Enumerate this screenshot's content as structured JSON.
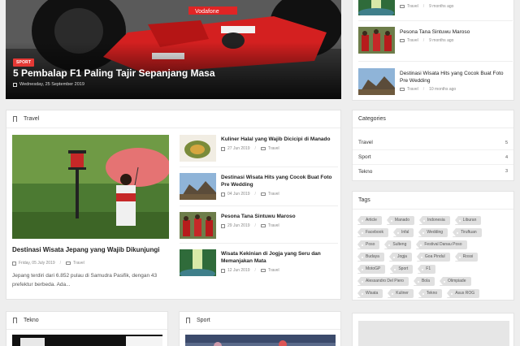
{
  "hero": {
    "badge": "SPORT",
    "title": "5 Pembalap F1 Paling Tajir Sepanjang Masa",
    "date": "Wednesday, 25 September 2019",
    "car_brand": "Vodafone"
  },
  "travel": {
    "heading": "Travel",
    "main": {
      "title": "Destinasi Wisata Jepang yang Wajib Dikunjungi",
      "date": "Friday, 05 July 2019",
      "category": "Travel",
      "excerpt_line1": "Jepang terdiri dari 6.852 pulau di Samudra Pasifik, dengan 43",
      "excerpt_line2": "prefektur berbeda. Ada..."
    },
    "items": [
      {
        "title": "Kuliner Halal yang Wajib Dicicipi di Manado",
        "date": "27 Jun 2019",
        "category": "Travel"
      },
      {
        "title_line1": "Destinasi Wisata Hits yang Cocok Buat Foto",
        "title_line2": "Pre Wedding",
        "date": "04 Jun 2019",
        "category": "Travel"
      },
      {
        "title": "Pesona Tana Sintuwu Maroso",
        "date": "29 Jun 2019",
        "category": "Travel"
      },
      {
        "title_line1": "Wisata Kekinian di Jogja yang Seru dan",
        "title_line2": "Memanjakan Mata",
        "date": "12 Jun 2019",
        "category": "Travel"
      }
    ]
  },
  "recent": {
    "items": [
      {
        "category": "Travel",
        "time": "9 months ago"
      },
      {
        "title": "Pesona Tana Sintuwu Maroso",
        "category": "Travel",
        "time": "9 months ago"
      },
      {
        "title_line1": "Destinasi Wisata Hits yang Cocok Buat Foto",
        "title_line2": "Pre Wedding",
        "category": "Travel",
        "time": "10 months ago"
      }
    ]
  },
  "categories": {
    "heading": "Categories",
    "items": [
      {
        "name": "Travel",
        "count": "5"
      },
      {
        "name": "Sport",
        "count": "4"
      },
      {
        "name": "Tekno",
        "count": "3"
      }
    ]
  },
  "tags": {
    "heading": "Tags",
    "rows": [
      [
        "Article",
        "Manado",
        "Indonesia",
        "Liburan"
      ],
      [
        "Facebook",
        "Infal",
        "Wedding",
        "Tiruftuan"
      ],
      [
        "Poso",
        "Sulteng",
        "Festival Danau Poso"
      ],
      [
        "Budaya",
        "Jogja",
        "Goa Pindul",
        "Rossi"
      ],
      [
        "MotoGP",
        "Sport",
        "F1"
      ],
      [
        "Alessandro Del Piero",
        "Bola",
        "Olimpiade"
      ],
      [
        "Wisata",
        "Kuliner",
        "Tekno",
        "Asus ROG"
      ]
    ]
  },
  "tekno": {
    "heading": "Tekno"
  },
  "sport": {
    "heading": "Sport"
  },
  "colors": {
    "badge": "#e53935",
    "background": "#eeeeee",
    "card": "#ffffff"
  }
}
